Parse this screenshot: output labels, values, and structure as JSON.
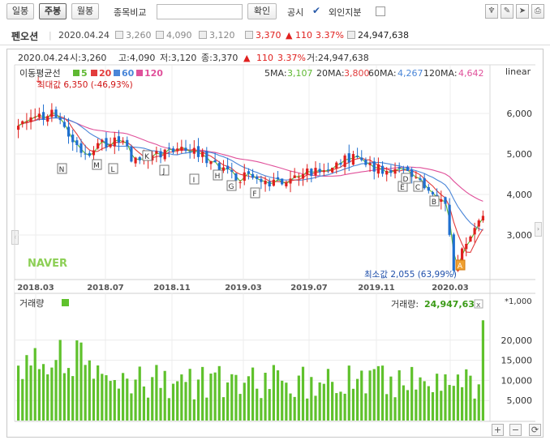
{
  "toolbar": {
    "daily": "일봉",
    "weekly": "주봉",
    "monthly": "월봉",
    "compare_label": "종목비교",
    "compare_value": "",
    "confirm": "확인",
    "disclosure": "공시",
    "disclosure_check": "✔",
    "foreign": "외인지분"
  },
  "stock": {
    "name": "펜오션",
    "date": "2020.04.24",
    "open": "3,260",
    "high": "4,090",
    "low": "3,120",
    "close": "3,370",
    "change": "▲ 110",
    "change_pct": "3.37%",
    "volume": "24,947,638"
  },
  "chart_header": {
    "date": "2020.04.24",
    "open_label": "시:3,260",
    "high_label": "고:4,090",
    "low_label": "저:3,120",
    "close_label": "종:3,370",
    "arrow": "▲",
    "change": "110",
    "change_pct": "3.37%",
    "volume_label": "거:24,947,638"
  },
  "legend": {
    "title": "이동평균선",
    "ma5": "5",
    "ma20": "20",
    "ma60": "60",
    "ma120": "120",
    "ma5_text": "5MA:",
    "ma5_val": "3,107",
    "ma20_text": "20MA:",
    "ma20_val": "3,800",
    "ma60_text": "60MA:",
    "ma60_val": "4,267",
    "ma120_text": "120MA:",
    "ma120_val": "4,642",
    "scale": "linear"
  },
  "annotations": {
    "max": "최대값 6,350 (-46,93%)",
    "min": "최소값 2,055 (63,99%)",
    "watermark": "NAVER"
  },
  "volume_panel": {
    "title": "거래량",
    "label": "거래량:",
    "value": "24,947,638",
    "unit": "*1,000",
    "close": "x"
  },
  "colors": {
    "up": "#e0201e",
    "down": "#1f6fd0",
    "ma5": "#5fb832",
    "ma20": "#e23c3c",
    "ma60": "#4a86d8",
    "ma120": "#e0509a",
    "volume": "#5fc12c"
  },
  "chart_data": {
    "type": "candlestick",
    "price_axis": {
      "min": 2000,
      "max": 6600,
      "ticks": [
        "6,000",
        "5,000",
        "4,000",
        "3,000"
      ],
      "tick_values": [
        6000,
        5000,
        4000,
        3000
      ]
    },
    "x_ticks": [
      "2018.03",
      "2018.07",
      "2018.11",
      "2019.03",
      "2019.07",
      "2019.11",
      "2020.03"
    ],
    "event_markers": [
      "N",
      "M",
      "L",
      "K",
      "J",
      "I",
      "H",
      "G",
      "F",
      "E",
      "D",
      "C",
      "B",
      "A"
    ],
    "volume_axis": {
      "max": 25000,
      "ticks": [
        "20,000",
        "15,000",
        "10,000",
        "5,000"
      ],
      "tick_values": [
        20000,
        15000,
        10000,
        5000
      ]
    }
  }
}
